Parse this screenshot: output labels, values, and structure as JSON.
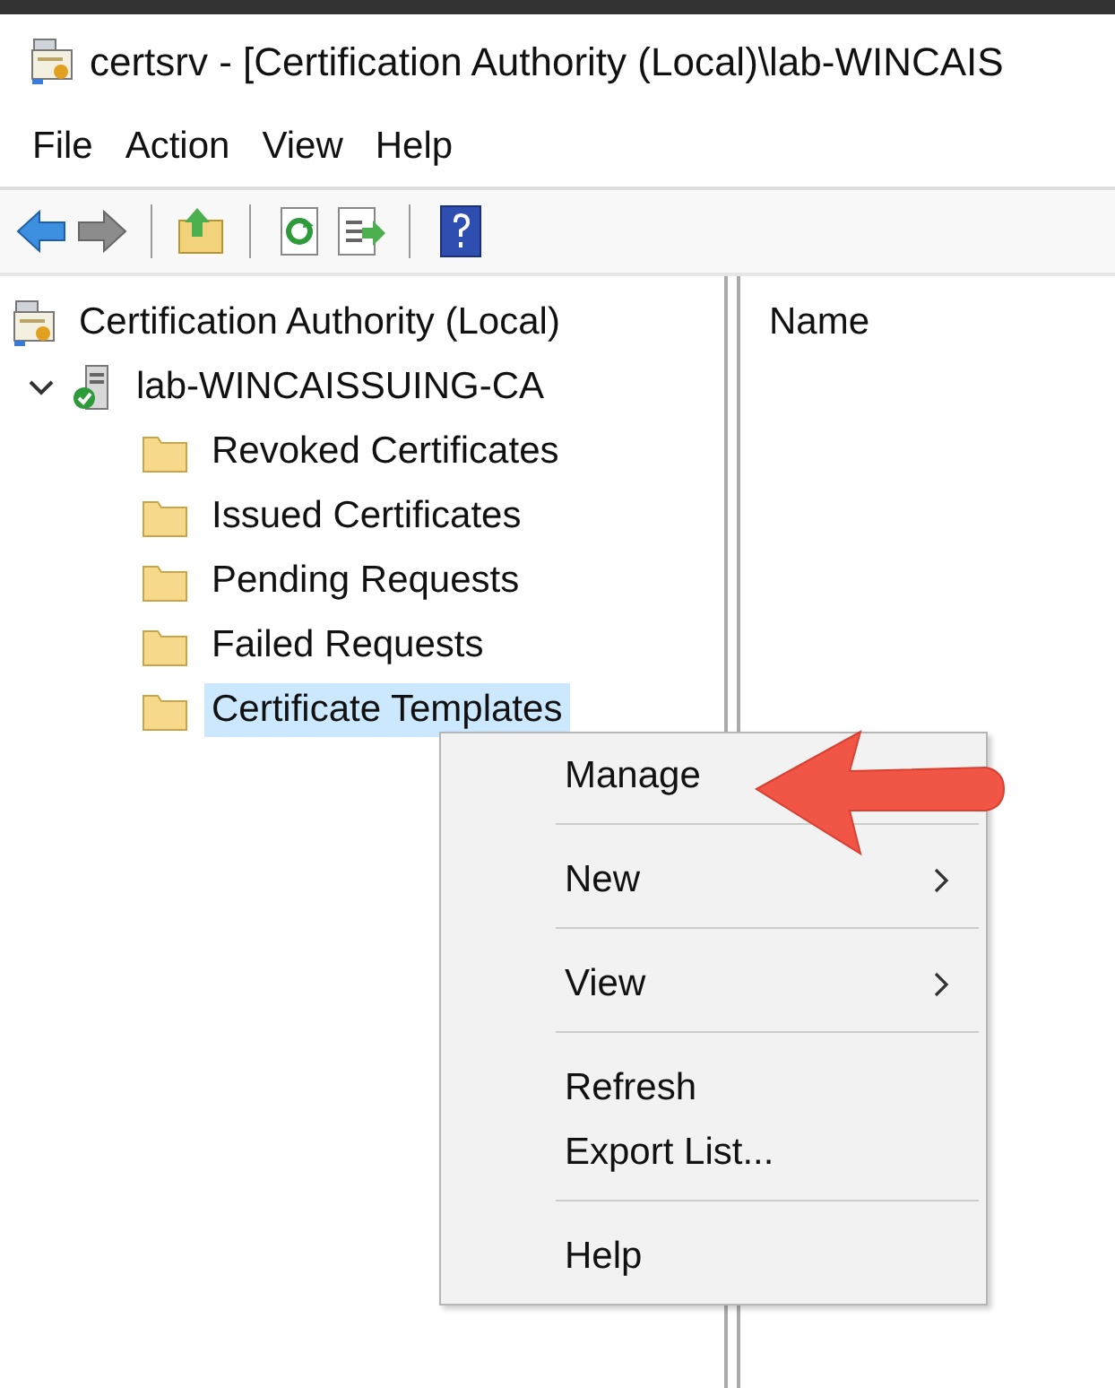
{
  "window": {
    "title": "certsrv - [Certification Authority (Local)\\lab-WINCAIS"
  },
  "menu_bar": [
    "File",
    "Action",
    "View",
    "Help"
  ],
  "tree": [
    {
      "label": "Certification Authority (Local)",
      "kind": "root",
      "children": [
        {
          "label": "lab-WINCAISSUING-CA",
          "kind": "server",
          "expanded": true,
          "children": [
            {
              "label": "Revoked Certificates",
              "kind": "folder",
              "selected": false
            },
            {
              "label": "Issued Certificates",
              "kind": "folder",
              "selected": false
            },
            {
              "label": "Pending Requests",
              "kind": "folder",
              "selected": false
            },
            {
              "label": "Failed Requests",
              "kind": "folder",
              "selected": false
            },
            {
              "label": "Certificate Templates",
              "kind": "folder",
              "selected": true
            }
          ]
        }
      ]
    }
  ],
  "list": {
    "columns": [
      "Name"
    ]
  },
  "context_menu": [
    {
      "kind": "item",
      "label": "Manage",
      "submenu": false
    },
    {
      "kind": "separator"
    },
    {
      "kind": "item",
      "label": "New",
      "submenu": true
    },
    {
      "kind": "separator"
    },
    {
      "kind": "item",
      "label": "View",
      "submenu": true
    },
    {
      "kind": "separator"
    },
    {
      "kind": "item",
      "label": "Refresh",
      "submenu": false
    },
    {
      "kind": "item",
      "label": "Export List...",
      "submenu": false
    },
    {
      "kind": "separator"
    },
    {
      "kind": "item",
      "label": "Help",
      "submenu": false
    }
  ]
}
